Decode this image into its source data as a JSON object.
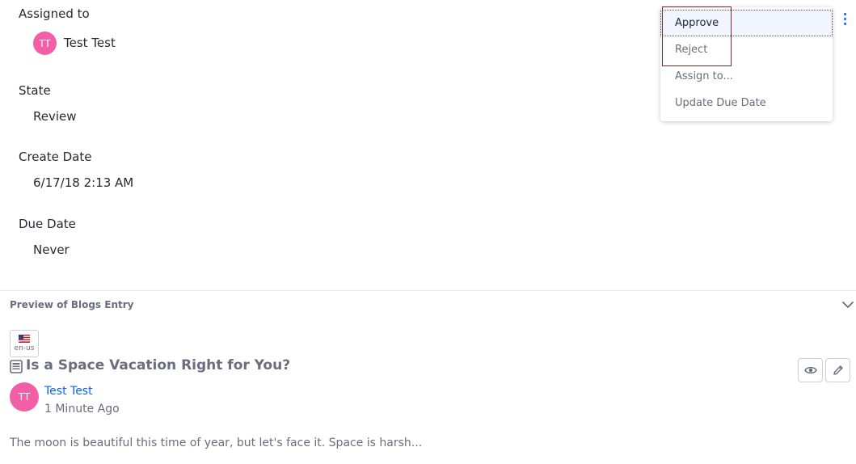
{
  "details": {
    "assigned_to_label": "Assigned to",
    "assignee_initials": "TT",
    "assignee_name": "Test Test",
    "state_label": "State",
    "state_value": "Review",
    "create_date_label": "Create Date",
    "create_date_value": "6/17/18 2:13 AM",
    "due_date_label": "Due Date",
    "due_date_value": "Never"
  },
  "actions_menu": {
    "kebab_icon": "ellipsis-vertical-icon",
    "items": [
      {
        "label": "Approve"
      },
      {
        "label": "Reject"
      },
      {
        "label": "Assign to..."
      },
      {
        "label": "Update Due Date"
      }
    ]
  },
  "preview": {
    "title": "Preview of Blogs Entry",
    "locale": "en-us",
    "entry_title": "Is a Space Vacation Right for You?",
    "author_initials": "TT",
    "author_name": "Test Test",
    "timestamp": "1 Minute Ago",
    "summary": "The moon is beautiful this time of year, but let's face it. Space is harsh..."
  },
  "colors": {
    "avatar": "#f35fa6",
    "link": "#0b5fff",
    "muted_text": "#6b6c7e"
  }
}
